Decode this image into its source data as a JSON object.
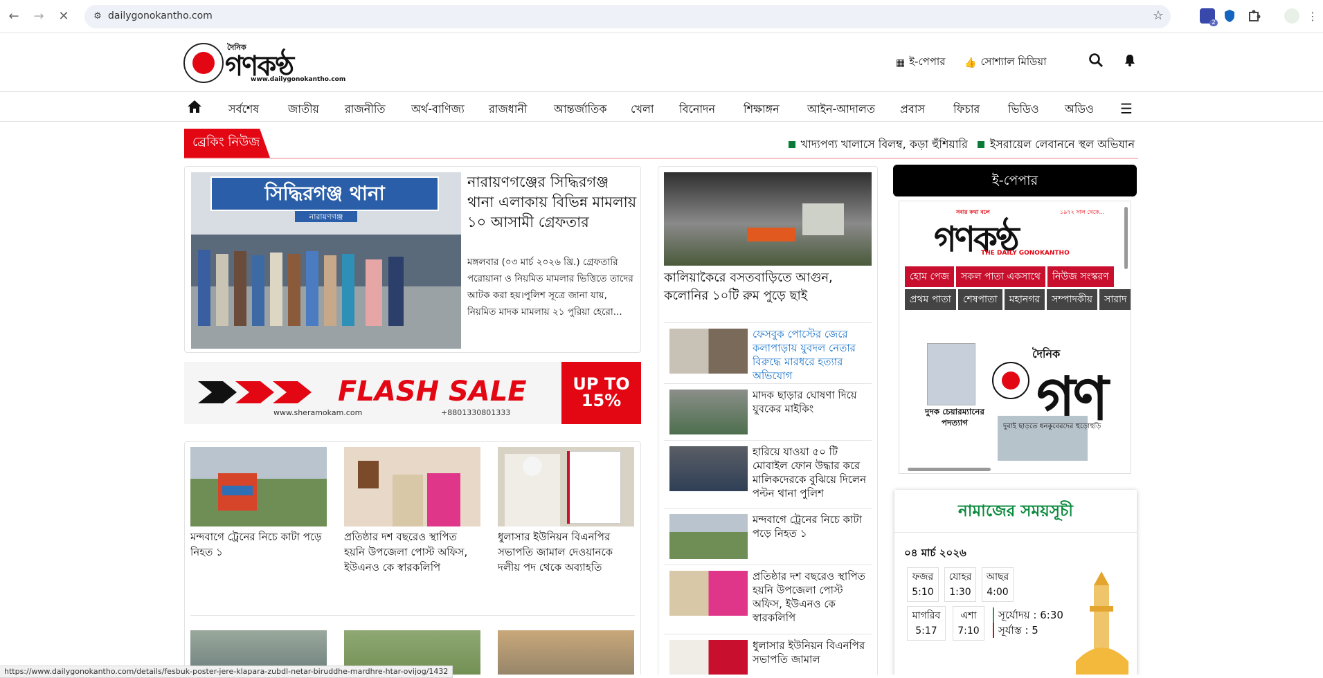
{
  "browser": {
    "url": "dailygonokantho.com",
    "status_url": "https://www.dailygonokantho.com/details/fesbuk-poster-jere-klapara-zubdl-netar-biruddhe-mardhre-htar-ovijog/1432",
    "extension_badge": "2"
  },
  "header": {
    "logo_dainik": "দৈনিক",
    "logo_word": "গণকণ্ঠ",
    "logo_website": "www.dailygonokantho.com",
    "epaper_link": "ই-পেপার",
    "social_link": "সোশ্যাল মিডিয়া"
  },
  "nav": {
    "items": [
      "সর্বশেষ",
      "জাতীয়",
      "রাজনীতি",
      "অর্থ-বাণিজ্য",
      "রাজধানী",
      "আন্তর্জাতিক",
      "খেলা",
      "বিনোদন",
      "শিক্ষাঙ্গন",
      "আইন-আদালত",
      "প্রবাস",
      "ফিচার",
      "ভিডিও",
      "অডিও"
    ]
  },
  "breaking": {
    "label": "ব্রেকিং নিউজ",
    "items": [
      "খাদ্যপণ্য খালাসে বিলম্ব, কড়া হুঁশিয়ারি",
      "ইসরায়েল লেবাননে স্থল অভিযান"
    ]
  },
  "lead": {
    "image_sign": "সিদ্ধিরগঞ্জ থানা",
    "image_sign_sub": "নারায়ণগঞ্জ",
    "title": "নারায়ণগঞ্জের সিদ্ধিরগঞ্জ থানা এলাকায় বিভিন্ন মামলায় ১০ আসামী গ্রেফতার",
    "summary": "মঙ্গলবার (০৩ মার্চ ২০২৬ খ্রি.) গ্রেফতারি পরোয়ানা ও নিয়মিত মামলার ভিত্তিতে তাদের আটক করা হয়।পুলিশ সূত্রে জানা যায়, নিয়মিত মাদক মামলায় ২১ পুরিয়া হেরো..."
  },
  "ad": {
    "headline": "FLASH SALE",
    "website": "www.sheramokam.com",
    "phone": "+8801330801333",
    "offer_line1": "UP TO",
    "offer_line2": "15%"
  },
  "grid": {
    "items": [
      {
        "title": "মন্দবাগে ট্রেনের নিচে কাটা পড়ে নিহত ১"
      },
      {
        "title": "প্রতিষ্ঠার দশ বছরেও স্থাপিত হয়নি উপজেলা পোস্ট অফিস, ইউএনও কে স্বারকলিপি"
      },
      {
        "title": "ধুলাসার ইউনিয়ন বিএনপির সভাপতি জামাল দেওয়ানকে দলীয় পদ থেকে অব্যাহতি"
      }
    ]
  },
  "middle": {
    "top_title": "কালিয়াকৈরে বসতবাড়িতে আগুন, কলোনির ১০টি রুম পুড়ে ছাই",
    "items": [
      {
        "title": "ফেসবুক পোস্টের জেরে কলাপাড়ায় যুবদল নেতার বিরুদ্ধে মারধরে হত্যার অভিযোগ"
      },
      {
        "title": "মাদক ছাড়ার ঘোষণা দিয়ে যুবকের মাইকিং"
      },
      {
        "title": "হারিয়ে যাওয়া ৫০ টি মোবাইল ফোন উদ্ধার করে মালিকদেরকে বুঝিয়ে দিলেন পল্টন থানা পুলিশ"
      },
      {
        "title": "মন্দবাগে ট্রেনের নিচে কাটা পড়ে নিহত ১"
      },
      {
        "title": "প্রতিষ্ঠার দশ বছরেও স্থাপিত হয়নি উপজেলা পোস্ট অফিস, ইউএনও কে স্বারকলিপি"
      },
      {
        "title": "ধুলাসার ইউনিয়ন বিএনপির সভাপতি জামাল"
      }
    ]
  },
  "epaper": {
    "heading": "ই-পেপার",
    "tagline": "সবার কথা বলে",
    "since": "১৯৭২ সাল থেকে...",
    "masthead": "গণকণ্ঠ",
    "english_name": "THE DAILY GONOKANTHO",
    "row1": [
      "হোম পেজ",
      "সকল পাতা একসাথে",
      "নিউজ সংস্করণ"
    ],
    "row2": [
      "প্রথম পাতা",
      "শেষপাতা",
      "মহানগর",
      "সম্পাদকীয়",
      "সারাদ"
    ],
    "dainik": "দৈনিক",
    "masthead_crop": "গণ",
    "dudok": "দুদক চেয়ারম্যানের পদত্যাগ",
    "dubai": "দুবাই ছাড়তে ধনকুবেরদের হুড়োহুড়ি"
  },
  "prayer": {
    "heading": "নামাজের সময়সূচী",
    "date": "০৪ মার্চ ২০২৬",
    "times": [
      {
        "name": "ফজর",
        "time": "5:10"
      },
      {
        "name": "যোহর",
        "time": "1:30"
      },
      {
        "name": "আছর",
        "time": "4:00"
      },
      {
        "name": "মাগরিব",
        "time": "5:17"
      },
      {
        "name": "এশা",
        "time": "7:10"
      }
    ],
    "sunrise": "সূর্যোদয় : 6:30",
    "sunset": "সূর্যাস্ত : 5"
  },
  "colors": {
    "brand_red": "#e30613",
    "prayer_green": "#0a8a3c",
    "ticker_green": "#0a7a39"
  }
}
